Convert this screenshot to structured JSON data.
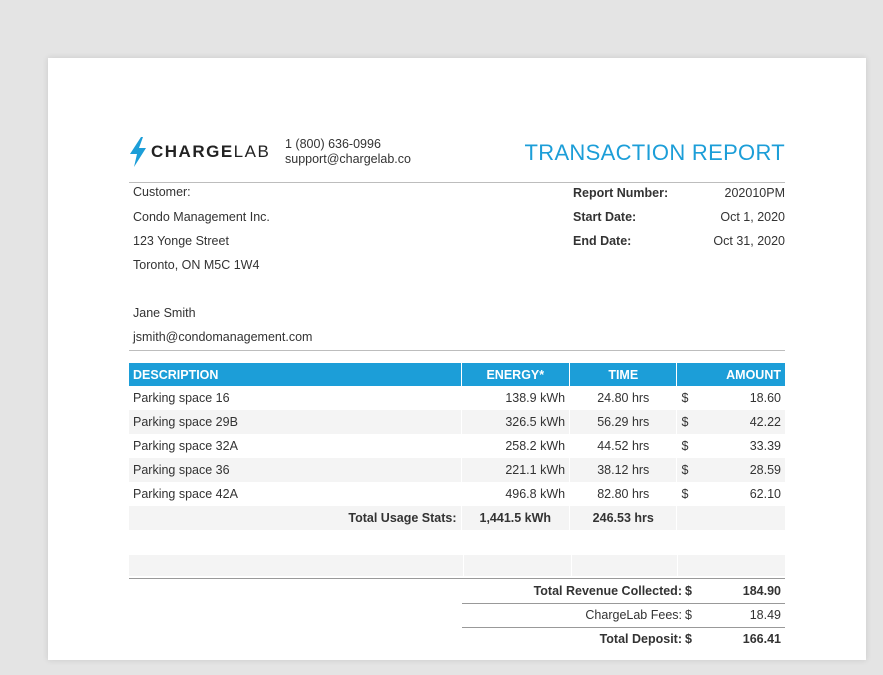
{
  "header": {
    "brand_bold": "CHARGE",
    "brand_light": "LAB",
    "phone": "1 (800) 636-0996",
    "email": "support@chargelab.co",
    "title": "TRANSACTION REPORT",
    "brand_color": "#1c9ed8"
  },
  "customer": {
    "label": "Customer:",
    "company": "Condo Management Inc.",
    "street": "123 Yonge Street",
    "city": "Toronto, ON M5C 1W4",
    "contact_name": "Jane Smith",
    "contact_email": "jsmith@condomanagement.com"
  },
  "report_meta": {
    "number_label": "Report Number:",
    "number": "202010PM",
    "start_label": "Start Date:",
    "start": "Oct 1, 2020",
    "end_label": "End Date:",
    "end": "Oct 31, 2020"
  },
  "table": {
    "headers": {
      "description": "DESCRIPTION",
      "energy": "ENERGY*",
      "time": "TIME",
      "amount": "AMOUNT"
    },
    "currency": "$",
    "rows": [
      {
        "description": "Parking space 16",
        "energy": "138.9 kWh",
        "time": "24.80 hrs",
        "amount": "18.60"
      },
      {
        "description": "Parking space 29B",
        "energy": "326.5 kWh",
        "time": "56.29 hrs",
        "amount": "42.22"
      },
      {
        "description": "Parking space 32A",
        "energy": "258.2 kWh",
        "time": "44.52 hrs",
        "amount": "33.39"
      },
      {
        "description": "Parking space 36",
        "energy": "221.1 kWh",
        "time": "38.12 hrs",
        "amount": "28.59"
      },
      {
        "description": "Parking space 42A",
        "energy": "496.8 kWh",
        "time": "82.80 hrs",
        "amount": "62.10"
      }
    ],
    "totals": {
      "label": "Total Usage Stats:",
      "energy": "1,441.5 kWh",
      "time": "246.53 hrs"
    }
  },
  "summary": {
    "revenue_label": "Total Revenue Collected:",
    "revenue": "184.90",
    "fees_label": "ChargeLab Fees:",
    "fees": "18.49",
    "deposit_label": "Total Deposit:",
    "deposit": "166.41",
    "currency": "$"
  }
}
